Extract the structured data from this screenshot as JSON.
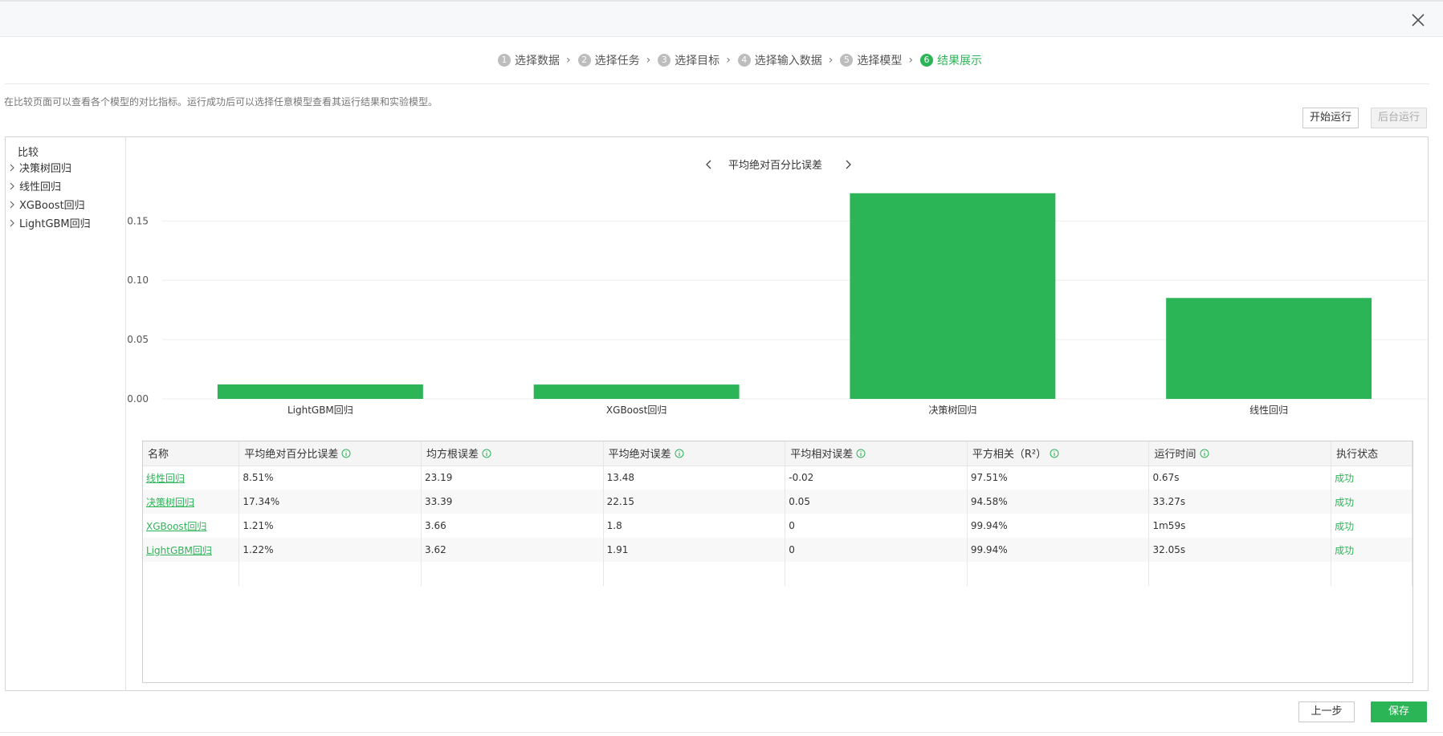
{
  "steps": [
    {
      "num": "1",
      "label": "选择数据"
    },
    {
      "num": "2",
      "label": "选择任务"
    },
    {
      "num": "3",
      "label": "选择目标"
    },
    {
      "num": "4",
      "label": "选择输入数据"
    },
    {
      "num": "5",
      "label": "选择模型"
    },
    {
      "num": "6",
      "label": "结果展示"
    }
  ],
  "description": "在比较页面可以查看各个模型的对比指标。运行成功后可以选择任意模型查看其运行结果和实验模型。",
  "buttons": {
    "run": "开始运行",
    "background": "后台运行",
    "prev": "上一步",
    "save": "保存"
  },
  "sidebar": {
    "root": "比较",
    "items": [
      "决策树回归",
      "线性回归",
      "XGBoost回归",
      "LightGBM回归"
    ]
  },
  "chart_nav_title": "平均绝对百分比误差",
  "chart_data": {
    "type": "bar",
    "title": "平均绝对百分比误差",
    "categories": [
      "LightGBM回归",
      "XGBoost回归",
      "决策树回归",
      "线性回归"
    ],
    "values": [
      0.0122,
      0.0121,
      0.1734,
      0.0851
    ],
    "yticks": [
      "0.00",
      "0.05",
      "0.10",
      "0.15"
    ],
    "ylim": [
      0,
      0.18
    ],
    "color": "#2bb556",
    "grid": true
  },
  "table": {
    "headers": [
      "名称",
      "平均绝对百分比误差",
      "均方根误差",
      "平均绝对误差",
      "平均相对误差",
      "平方相关（R²）",
      "运行时间",
      "执行状态"
    ],
    "header_info": [
      false,
      true,
      true,
      true,
      true,
      true,
      true,
      false
    ],
    "rows": [
      [
        "线性回归",
        "8.51%",
        "23.19",
        "13.48",
        "-0.02",
        "97.51%",
        "0.67s",
        "成功"
      ],
      [
        "决策树回归",
        "17.34%",
        "33.39",
        "22.15",
        "0.05",
        "94.58%",
        "33.27s",
        "成功"
      ],
      [
        "XGBoost回归",
        "1.21%",
        "3.66",
        "1.8",
        "0",
        "99.94%",
        "1m59s",
        "成功"
      ],
      [
        "LightGBM回归",
        "1.22%",
        "3.62",
        "1.91",
        "0",
        "99.94%",
        "32.05s",
        "成功"
      ]
    ]
  },
  "colors": {
    "accent": "#2bb556",
    "inactive_step": "#bdbdbd"
  }
}
